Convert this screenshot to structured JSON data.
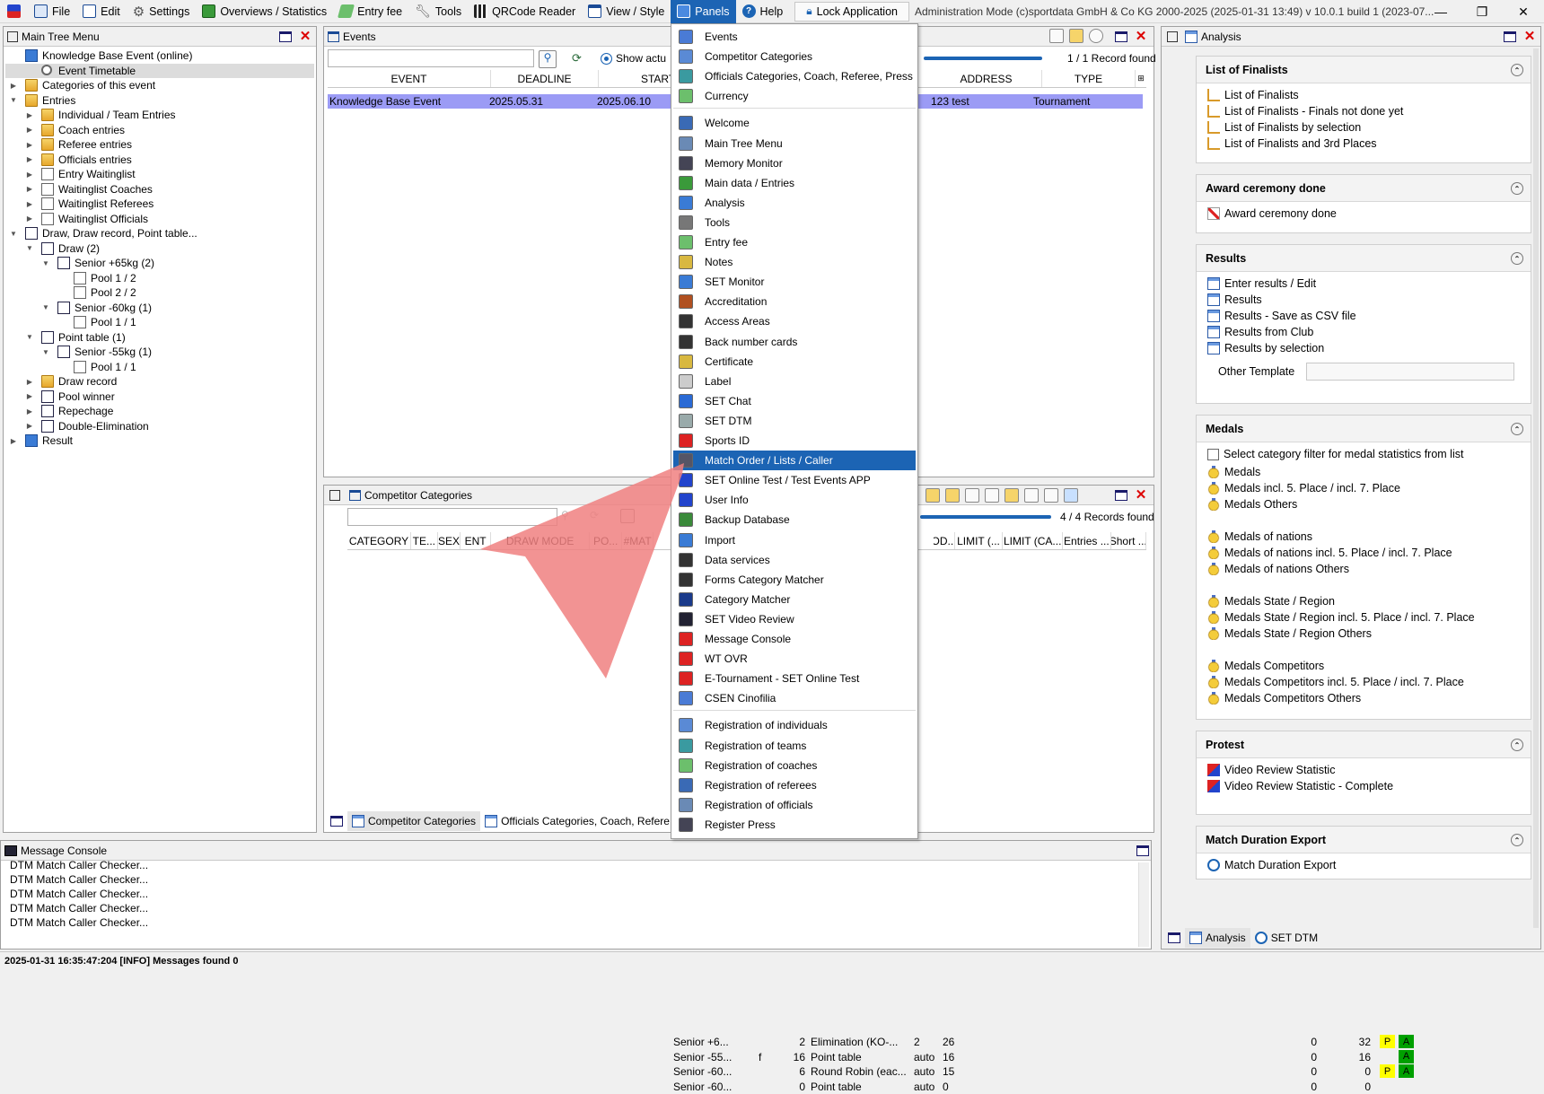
{
  "menubar": {
    "items": [
      {
        "label": "File",
        "icon": "file-icon"
      },
      {
        "label": "Edit",
        "icon": "edit-icon"
      },
      {
        "label": "Settings",
        "icon": "gear-icon"
      },
      {
        "label": "Overviews / Statistics",
        "icon": "statistics-icon"
      },
      {
        "label": "Entry fee",
        "icon": "money-icon"
      },
      {
        "label": "Tools",
        "icon": "wrench-icon"
      },
      {
        "label": "QRCode Reader",
        "icon": "qrcode-icon"
      },
      {
        "label": "View / Style",
        "icon": "view-icon"
      },
      {
        "label": "Panels",
        "icon": "panels-icon"
      },
      {
        "label": "Help",
        "icon": "help-icon"
      }
    ],
    "lock_label": "Lock Application",
    "info": "Administration Mode (c)sportdata GmbH & Co KG 2000-2025 (2025-01-31 13:49)  v 10.0.1 build 1 (2023-07...",
    "accent": "#1c64b4"
  },
  "tree_panel": {
    "title": "Main Tree Menu",
    "items": [
      {
        "label": "Knowledge Base Event (online)"
      },
      {
        "label": "Event Timetable"
      },
      {
        "label": "Categories of this event"
      },
      {
        "label": "Entries"
      },
      {
        "label": "Individual / Team Entries"
      },
      {
        "label": "Coach entries"
      },
      {
        "label": "Referee entries"
      },
      {
        "label": "Officials entries"
      },
      {
        "label": "Entry Waitinglist"
      },
      {
        "label": "Waitinglist Coaches"
      },
      {
        "label": "Waitinglist Referees"
      },
      {
        "label": "Waitinglist Officials"
      },
      {
        "label": "Draw, Draw record, Point table..."
      },
      {
        "label": "Draw (2)"
      },
      {
        "label": "Senior +65kg (2)"
      },
      {
        "label": "Pool 1 / 2"
      },
      {
        "label": "Pool 2 / 2"
      },
      {
        "label": "Senior -60kg (1)"
      },
      {
        "label": "Pool 1 / 1"
      },
      {
        "label": "Point table (1)"
      },
      {
        "label": "Senior -55kg (1)"
      },
      {
        "label": "Pool 1 / 1"
      },
      {
        "label": "Draw record"
      },
      {
        "label": "Pool winner"
      },
      {
        "label": "Repechage"
      },
      {
        "label": "Double-Elimination"
      },
      {
        "label": "Result"
      }
    ]
  },
  "events_panel": {
    "title": "Events",
    "show_label": "Show actu",
    "record_count": "1 / 1 Record found",
    "columns": [
      "EVENT",
      "DEADLINE",
      "START DA",
      "ADDRESS",
      "TYPE"
    ],
    "row": {
      "event": "Knowledge Base Event",
      "deadline": "2025.05.31",
      "start": "2025.06.10",
      "address": "123 test",
      "type": "Tournament"
    },
    "row_color": "#9b9bf5"
  },
  "categories_panel": {
    "title": "Competitor Categories",
    "record_count": "4 / 4 Records found",
    "columns": [
      "CATEGORY",
      "TE...",
      "SEX",
      "ENT",
      "DRAW MODE",
      "PO...",
      "#MAT",
      "OD...",
      "LIMIT (...",
      "LIMIT (CA...",
      "Entries ...",
      "Short ..."
    ],
    "rows": [
      {
        "cat": "Senior +6...",
        "sex": "",
        "ent": "2",
        "mode": "Elimination (KO-...",
        "po": "2",
        "mat": "26",
        "l1": "0",
        "l2": "32",
        "b1": "P",
        "b2": "A"
      },
      {
        "cat": "Senior -55...",
        "sex": "f",
        "ent": "16",
        "mode": "Point table",
        "po": "auto",
        "mat": "16",
        "l1": "0",
        "l2": "16",
        "b1": "",
        "b2": "A"
      },
      {
        "cat": "Senior -60...",
        "sex": "",
        "ent": "6",
        "mode": "Round Robin (eac...",
        "po": "auto",
        "mat": "15",
        "l1": "0",
        "l2": "0",
        "b1": "P",
        "b2": "A"
      },
      {
        "cat": "Senior -60...",
        "sex": "",
        "ent": "0",
        "mode": "Point table",
        "po": "auto",
        "mat": "0",
        "l1": "0",
        "l2": "0",
        "b1": "",
        "b2": ""
      }
    ],
    "tabs": [
      "Competitor Categories",
      "Officials Categories, Coach, Refere"
    ]
  },
  "panels_menu": {
    "group1": [
      "Events",
      "Competitor Categories",
      "Officials Categories, Coach, Referee, Press",
      "Currency"
    ],
    "group2": [
      "Welcome",
      "Main Tree Menu",
      "Memory Monitor",
      "Main data / Entries",
      "Analysis",
      "Tools",
      "Entry fee",
      "Notes",
      "SET Monitor",
      "Accreditation",
      "Access Areas",
      "Back number cards",
      "Certificate",
      "Label",
      "SET Chat",
      "SET DTM",
      "Sports ID",
      "Match Order / Lists / Caller",
      "SET Online Test / Test Events APP",
      "User Info",
      "Backup Database",
      "Import",
      "Data services",
      "Forms Category Matcher",
      "Category Matcher",
      "SET Video Review",
      "Message Console",
      "WT OVR",
      "E-Tournament - SET Online Test",
      "CSEN Cinofilia"
    ],
    "group3": [
      "Registration of individuals",
      "Registration of teams",
      "Registration of coaches",
      "Registration of referees",
      "Registration of officials",
      "Register Press"
    ],
    "highlighted": "Match Order / Lists / Caller"
  },
  "analysis_panel": {
    "title": "Analysis",
    "sections": [
      {
        "title": "List of Finalists",
        "items": [
          "List of Finalists",
          "List of Finalists - Finals not done yet",
          "List of Finalists by selection",
          "List of Finalists and 3rd Places"
        ]
      },
      {
        "title": "Award ceremony done",
        "items": [
          "Award ceremony done"
        ]
      },
      {
        "title": "Results",
        "items": [
          "Enter results / Edit",
          "Results",
          "Results - Save as CSV file",
          "Results from Club",
          "Results by selection"
        ],
        "other_template": "Other Template"
      },
      {
        "title": "Medals",
        "checkbox": "Select category filter for medal statistics from list",
        "items": [
          "Medals",
          "Medals incl. 5. Place / incl. 7. Place",
          "Medals Others",
          "Medals of nations",
          "Medals of nations incl. 5. Place / incl. 7. Place",
          "Medals of nations Others",
          "Medals State / Region",
          "Medals State / Region incl. 5. Place / incl. 7. Place",
          "Medals State / Region Others",
          "Medals Competitors",
          "Medals Competitors incl. 5. Place / incl. 7. Place",
          "Medals Competitors Others"
        ]
      },
      {
        "title": "Protest",
        "items": [
          "Video Review Statistic",
          "Video Review Statistic - Complete"
        ]
      },
      {
        "title": "Match Duration Export",
        "items": [
          "Match Duration Export"
        ]
      }
    ],
    "tabs": [
      "Analysis",
      "SET DTM"
    ]
  },
  "console": {
    "title": "Message Console",
    "lines": [
      "DTM Match Caller Checker...",
      "DTM Match Caller Checker...",
      "DTM Match Caller Checker...",
      "DTM Match Caller Checker...",
      "DTM Match Caller Checker..."
    ]
  },
  "status": {
    "text": "2025-01-31 16:35:47:204 [INFO] Messages found 0"
  },
  "annotation": {
    "arrow_color": "#f08080"
  }
}
